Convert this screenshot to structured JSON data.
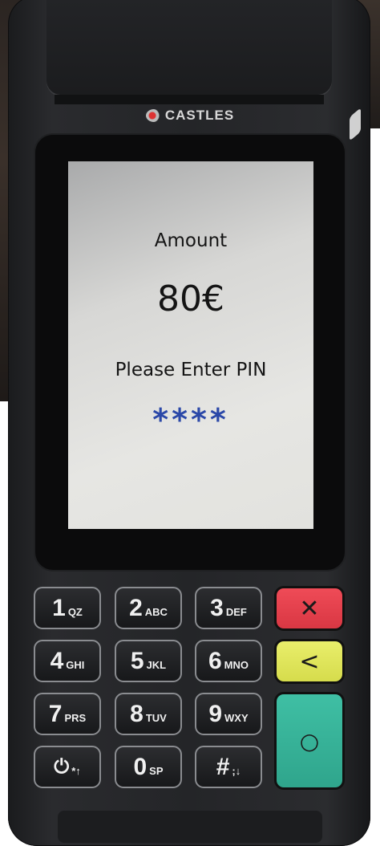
{
  "device": {
    "brand": "CASTLES"
  },
  "screen": {
    "amount_label": "Amount",
    "amount_value": "80€",
    "prompt": "Please Enter PIN",
    "pin_mask": "****"
  },
  "keypad": {
    "k1": {
      "digit": "1",
      "letters": "QZ"
    },
    "k2": {
      "digit": "2",
      "letters": "ABC"
    },
    "k3": {
      "digit": "3",
      "letters": "DEF"
    },
    "k4": {
      "digit": "4",
      "letters": "GHI"
    },
    "k5": {
      "digit": "5",
      "letters": "JKL"
    },
    "k6": {
      "digit": "6",
      "letters": "MNO"
    },
    "k7": {
      "digit": "7",
      "letters": "PRS"
    },
    "k8": {
      "digit": "8",
      "letters": "TUV"
    },
    "k9": {
      "digit": "9",
      "letters": "WXY"
    },
    "kpower": {
      "digit": "⏻",
      "letters": "*↑"
    },
    "k0": {
      "digit": "0",
      "letters": "SP"
    },
    "khash": {
      "digit": "#",
      "letters": ";↓"
    },
    "cancel": "✕",
    "clear": "<",
    "enter": "○"
  },
  "colors": {
    "cancel": "#e0404c",
    "clear": "#dde255",
    "enter": "#36b398",
    "pin": "#2b48a8"
  }
}
